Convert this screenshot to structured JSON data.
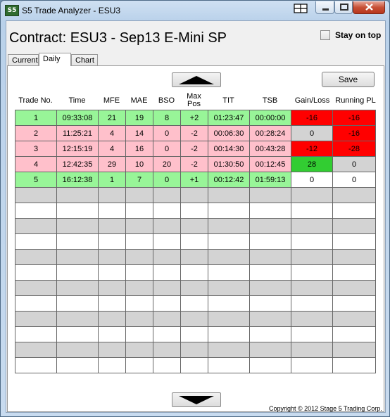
{
  "window": {
    "title": "S5 Trade Analyzer - ESU3",
    "app_icon": "S5"
  },
  "header": {
    "contract": "Contract: ESU3 - Sep13 E-Mini SP",
    "stay_on_top_label": "Stay on top",
    "stay_on_top_checked": false
  },
  "tabs": [
    {
      "label": "Current",
      "active": false
    },
    {
      "label": "Daily",
      "active": true
    },
    {
      "label": "Chart",
      "active": false
    }
  ],
  "toolbar": {
    "save_label": "Save"
  },
  "columns": [
    "Trade No.",
    "Time",
    "MFE",
    "MAE",
    "BSO",
    "Max Pos",
    "TIT",
    "TSB",
    "Gain/Loss",
    "Running PL"
  ],
  "rows": [
    {
      "cells": [
        "1",
        "09:33:08",
        "21",
        "19",
        "8",
        "+2",
        "01:23:47",
        "00:00:00",
        "-16",
        "-16"
      ],
      "row_color": "green",
      "gain_color": "red",
      "running_color": "red"
    },
    {
      "cells": [
        "2",
        "11:25:21",
        "4",
        "14",
        "0",
        "-2",
        "00:06:30",
        "00:28:24",
        "0",
        "-16"
      ],
      "row_color": "pink",
      "gain_color": "gray",
      "running_color": "red"
    },
    {
      "cells": [
        "3",
        "12:15:19",
        "4",
        "16",
        "0",
        "-2",
        "00:14:30",
        "00:43:28",
        "-12",
        "-28"
      ],
      "row_color": "pink",
      "gain_color": "red",
      "running_color": "red"
    },
    {
      "cells": [
        "4",
        "12:42:35",
        "29",
        "10",
        "20",
        "-2",
        "01:30:50",
        "00:12:45",
        "28",
        "0"
      ],
      "row_color": "pink",
      "gain_color": "green",
      "running_color": "gray"
    },
    {
      "cells": [
        "5",
        "16:12:38",
        "1",
        "7",
        "0",
        "+1",
        "00:12:42",
        "01:59:13",
        "0",
        "0"
      ],
      "row_color": "green",
      "gain_color": "white",
      "running_color": "white"
    }
  ],
  "empty_row_count": 12,
  "colors": {
    "green": "#98f598",
    "pink": "#ffc0cb",
    "red": "#ff0000",
    "gray": "#d3d3d3",
    "bright_green": "#32cd32",
    "white": "#ffffff"
  },
  "footer": {
    "copyright": "Copyright © 2012 Stage 5 Trading Corp."
  }
}
